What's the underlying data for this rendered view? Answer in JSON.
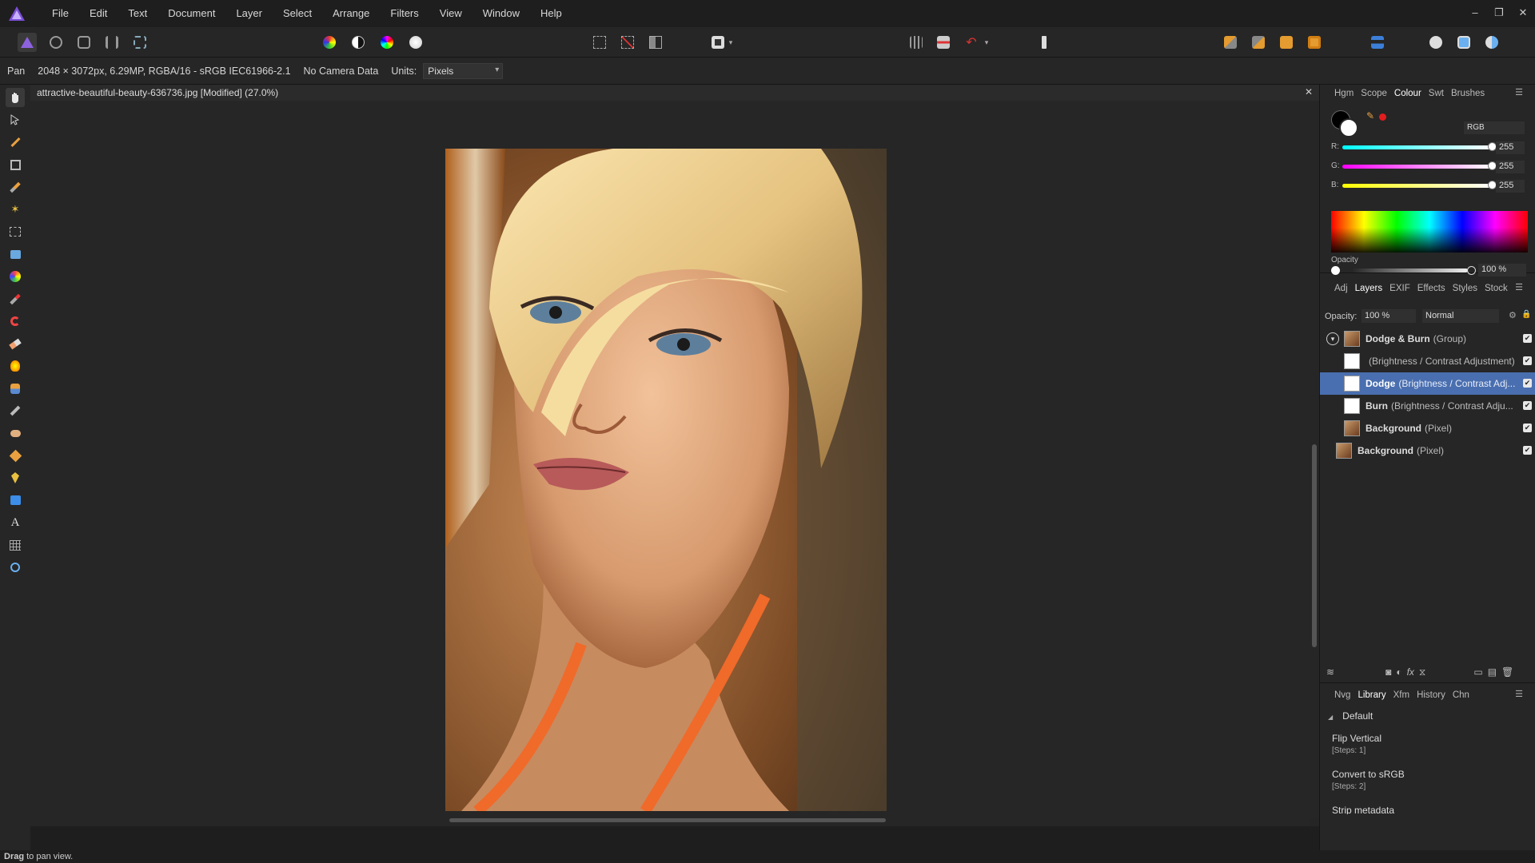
{
  "menu": [
    "File",
    "Edit",
    "Text",
    "Document",
    "Layer",
    "Select",
    "Arrange",
    "Filters",
    "View",
    "Window",
    "Help"
  ],
  "window_controls": {
    "minimize": "–",
    "restore": "❐",
    "close": "✕"
  },
  "context": {
    "tool": "Pan",
    "info": "2048 × 3072px, 6.29MP, RGBA/16 - sRGB IEC61966-2.1",
    "camera": "No Camera Data",
    "units_label": "Units:",
    "units_value": "Pixels"
  },
  "document": {
    "title": "attractive-beautiful-beauty-636736.jpg [Modified] (27.0%)"
  },
  "colour_panel": {
    "tabs": [
      "Hgm",
      "Scope",
      "Colour",
      "Swt",
      "Brushes"
    ],
    "active_tab": "Colour",
    "model": "RGB",
    "r_label": "R:",
    "g_label": "G:",
    "b_label": "B:",
    "r": "255",
    "g": "255",
    "b": "255",
    "opacity_label": "Opacity",
    "opacity": "100 %",
    "accent": "#e11d1d"
  },
  "layers_panel": {
    "tabs": [
      "Adj",
      "Layers",
      "EXIF",
      "Effects",
      "Styles",
      "Stock"
    ],
    "active_tab": "Layers",
    "opacity_label": "Opacity:",
    "opacity": "100 %",
    "blend": "Normal",
    "rows": [
      {
        "name": "Dodge & Burn",
        "type": "(Group)"
      },
      {
        "name": "",
        "type": "(Brightness / Contrast Adjustment)"
      },
      {
        "name": "Dodge",
        "type": "(Brightness / Contrast Adj..."
      },
      {
        "name": "Burn",
        "type": "(Brightness / Contrast Adju..."
      },
      {
        "name": "Background",
        "type": "(Pixel)"
      },
      {
        "name": "Background",
        "type": "(Pixel)"
      }
    ]
  },
  "library_panel": {
    "tabs": [
      "Nvg",
      "Library",
      "Xfm",
      "History",
      "Chn"
    ],
    "active_tab": "Library",
    "group": "Default",
    "items": [
      {
        "name": "Flip Vertical",
        "steps": "[Steps: 1]"
      },
      {
        "name": "Convert to sRGB",
        "steps": "[Steps: 2]"
      },
      {
        "name": "Strip metadata",
        "steps": ""
      }
    ]
  },
  "status": {
    "bold": "Drag",
    "text": " to pan view."
  }
}
